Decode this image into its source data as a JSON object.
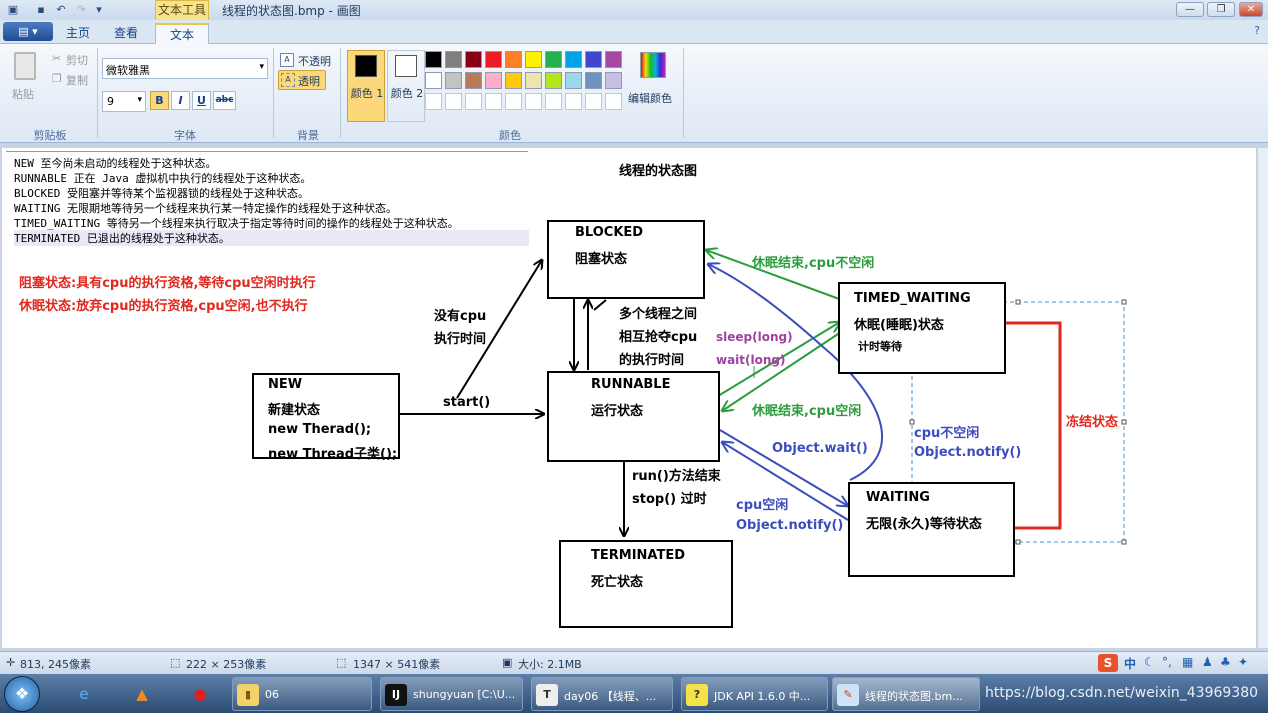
{
  "window": {
    "title": "线程的状态图.bmp - 画图",
    "context_tab": "文本工具",
    "minimize_glyph": "—",
    "maximize_glyph": "❐",
    "close_glyph": "✕"
  },
  "tabs": [
    {
      "label": "主页"
    },
    {
      "label": "查看"
    },
    {
      "label": "文本"
    }
  ],
  "app_menu_glyph": "▤ ▾",
  "ribbon": {
    "clipboard": {
      "paste": "粘贴",
      "cut": "剪切",
      "copy": "复制",
      "group": "剪贴板"
    },
    "font": {
      "family": "微软雅黑",
      "size": "9",
      "bold": "B",
      "italic": "I",
      "underline": "U",
      "strike": "abc",
      "group": "字体"
    },
    "background": {
      "opaque": "不透明",
      "transparent": "透明",
      "group": "背景"
    },
    "colors": {
      "color1": "颜色 1",
      "color2": "颜色 2",
      "edit": "编辑颜色",
      "group": "颜色"
    },
    "palette_row1": [
      "#000000",
      "#7f7f7f",
      "#880015",
      "#ed1c24",
      "#ff7f27",
      "#fff200",
      "#22b14c",
      "#00a2e8",
      "#3f48cc",
      "#a349a4"
    ],
    "palette_row2": [
      "#ffffff",
      "#c3c3c3",
      "#b97a57",
      "#ffaec9",
      "#ffc90e",
      "#efe4b0",
      "#b5e61d",
      "#99d9ea",
      "#7092be",
      "#c8bfe7"
    ],
    "palette_row3": [
      "#ffffff",
      "#ffffff",
      "#ffffff",
      "#ffffff",
      "#ffffff",
      "#ffffff",
      "#ffffff",
      "#ffffff",
      "#ffffff",
      "#ffffff"
    ],
    "color1_value": "#000000",
    "color2_value": "#ffffff"
  },
  "canvas": {
    "heading": "线程的状态图",
    "doc_lines": [
      "NEW 至今尚未启动的线程处于这种状态。",
      "RUNNABLE 正在 Java 虚拟机中执行的线程处于这种状态。",
      "BLOCKED 受阻塞并等待某个监视器锁的线程处于这种状态。",
      "WAITING 无限期地等待另一个线程来执行某一特定操作的线程处于这种状态。",
      "TIMED_WAITING 等待另一个线程来执行取决于指定等待时间的操作的线程处于这种状态。",
      "TERMINATED 已退出的线程处于这种状态。"
    ],
    "red_notes": [
      "阻塞状态:具有cpu的执行资格,等待cpu空闲时执行",
      "休眠状态:放弃cpu的执行资格,cpu空闲,也不执行"
    ],
    "states": {
      "new": {
        "name": "NEW",
        "desc": "新建状态",
        "line3": "new Therad();",
        "line4": "new Thread子类();"
      },
      "blocked": {
        "name": "BLOCKED",
        "desc": "阻塞状态"
      },
      "runnable": {
        "name": "RUNNABLE",
        "desc": "运行状态"
      },
      "terminated": {
        "name": "TERMINATED",
        "desc": "死亡状态"
      },
      "timed_waiting": {
        "name": "TIMED_WAITING",
        "desc": "休眠(睡眠)状态",
        "sub": "计时等待"
      },
      "waiting": {
        "name": "WAITING",
        "desc": "无限(永久)等待状态"
      }
    },
    "labels": {
      "no_cpu_1": "没有cpu",
      "no_cpu_2": "执行时间",
      "start": "start()",
      "compete_1": "多个线程之间",
      "compete_2": "相互抢夺cpu",
      "compete_3": "的执行时间",
      "sleep_end_no_cpu": "休眠结束,cpu不空闲",
      "sleep_long": "sleep(long)",
      "wait_long": "wait(long)",
      "sleep_end_cpu_free": "休眠结束,cpu空闲",
      "object_wait": "Object.wait()",
      "run_end_1": "run()方法结束",
      "run_end_2": "stop() 过时",
      "cpu_not_free": "cpu不空闲",
      "notify_top": "Object.notify()",
      "cpu_free": "cpu空闲",
      "notify_bottom": "Object.notify()",
      "frozen": "冻结状态"
    },
    "colors": {
      "green": "#2a9d3d",
      "blue": "#3b4dbd",
      "purple": "#a040a0",
      "red": "#e0281e"
    }
  },
  "statusbar": {
    "cursor_pos": "813, 245像素",
    "selection_size": "222 × 253像素",
    "image_size": "1347 × 541像素",
    "file_size": "大小: 2.1MB"
  },
  "taskbar": {
    "tasks": [
      {
        "icon": "folder-icon",
        "label": "06"
      },
      {
        "icon": "intellij-icon",
        "label": "shungyuan [C:\\U..."
      },
      {
        "icon": "typora-icon",
        "label": "day06 【线程、..."
      },
      {
        "icon": "help-icon",
        "label": "JDK API 1.6.0 中..."
      },
      {
        "icon": "paint-icon",
        "label": "线程的状态图.bm..."
      }
    ],
    "tray_text": "https://blog.csdn.net/weixin_43969380"
  }
}
